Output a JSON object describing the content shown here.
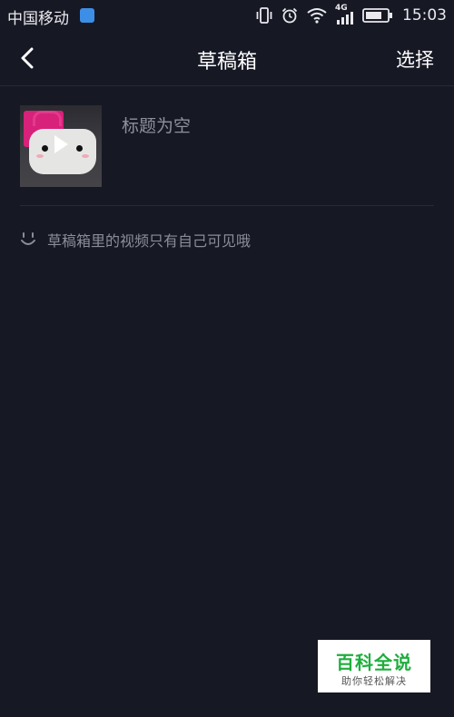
{
  "status_bar": {
    "carrier": "中国移动",
    "network": "4G",
    "time": "15:03"
  },
  "nav": {
    "title": "草稿箱",
    "select_label": "选择"
  },
  "drafts": [
    {
      "title": "标题为空"
    }
  ],
  "privacy_hint": "草稿箱里的视频只有自己可见哦",
  "watermark": {
    "main": "百科全说",
    "sub": "助你轻松解决"
  },
  "colors": {
    "background": "#161824",
    "divider": "#272a37",
    "muted_text": "#8b8d97",
    "watermark_green": "#1fae3d"
  }
}
